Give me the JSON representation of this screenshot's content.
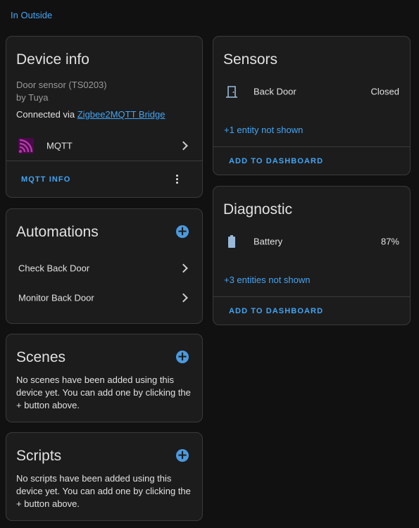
{
  "breadcrumb": {
    "area": "In Outside"
  },
  "device_info": {
    "title": "Device info",
    "model": "Door sensor (TS0203)",
    "manufacturer": "by Tuya",
    "connected_prefix": "Connected via ",
    "connected_link": "Zigbee2MQTT Bridge",
    "integration_label": "MQTT",
    "mqtt_info_button": "MQTT INFO"
  },
  "automations": {
    "title": "Automations",
    "items": [
      {
        "label": "Check Back Door"
      },
      {
        "label": "Monitor Back Door"
      }
    ]
  },
  "scenes": {
    "title": "Scenes",
    "empty_text": "No scenes have been added using this device yet. You can add one by clicking the + button above."
  },
  "scripts": {
    "title": "Scripts",
    "empty_text": "No scripts have been added using this device yet. You can add one by clicking the + button above."
  },
  "sensors": {
    "title": "Sensors",
    "entity_name": "Back Door",
    "entity_state": "Closed",
    "hidden_link": "+1 entity not shown",
    "add_button": "ADD TO DASHBOARD"
  },
  "diagnostic": {
    "title": "Diagnostic",
    "entity_name": "Battery",
    "entity_state": "87%",
    "hidden_link": "+3 entities not shown",
    "add_button": "ADD TO DASHBOARD"
  },
  "icons": {
    "add": "plus-circle-icon",
    "chevron": "chevron-right-icon",
    "menu": "dots-vertical-icon",
    "door": "door-icon",
    "battery": "battery-icon",
    "mqtt": "mqtt-icon"
  },
  "colors": {
    "accent": "#42a5f5",
    "mqtt_brand": "#660066"
  }
}
